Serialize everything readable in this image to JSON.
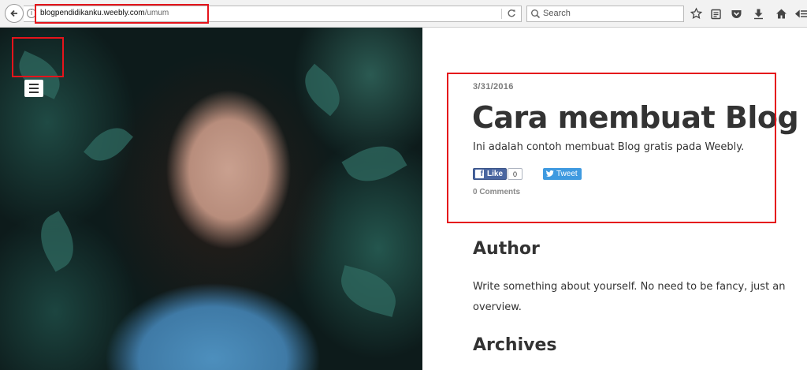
{
  "browser": {
    "url_domain": "blogpendidikanku.weebly.com",
    "url_path": "/umum",
    "search_placeholder": "Search",
    "toolbar_icons": [
      "star-icon",
      "reading-list-icon",
      "pocket-icon",
      "download-icon",
      "home-icon",
      "more-icon"
    ]
  },
  "post": {
    "date": "3/31/2016",
    "title": "Cara membuat Blog",
    "body": "Ini adalah contoh membuat Blog gratis pada Weebly.",
    "fb_like_label": "Like",
    "fb_like_count": "0",
    "tweet_label": "Tweet",
    "comments_label": "0 Comments"
  },
  "sidebar": {
    "author_heading": "Author",
    "author_text": "Write something about yourself. No need to be fancy, just an overview.",
    "archives_heading": "Archives"
  },
  "colors": {
    "annotation": "#e5141b",
    "facebook": "#4a66a0",
    "twitter": "#3f9ae0",
    "heading": "#333333"
  }
}
